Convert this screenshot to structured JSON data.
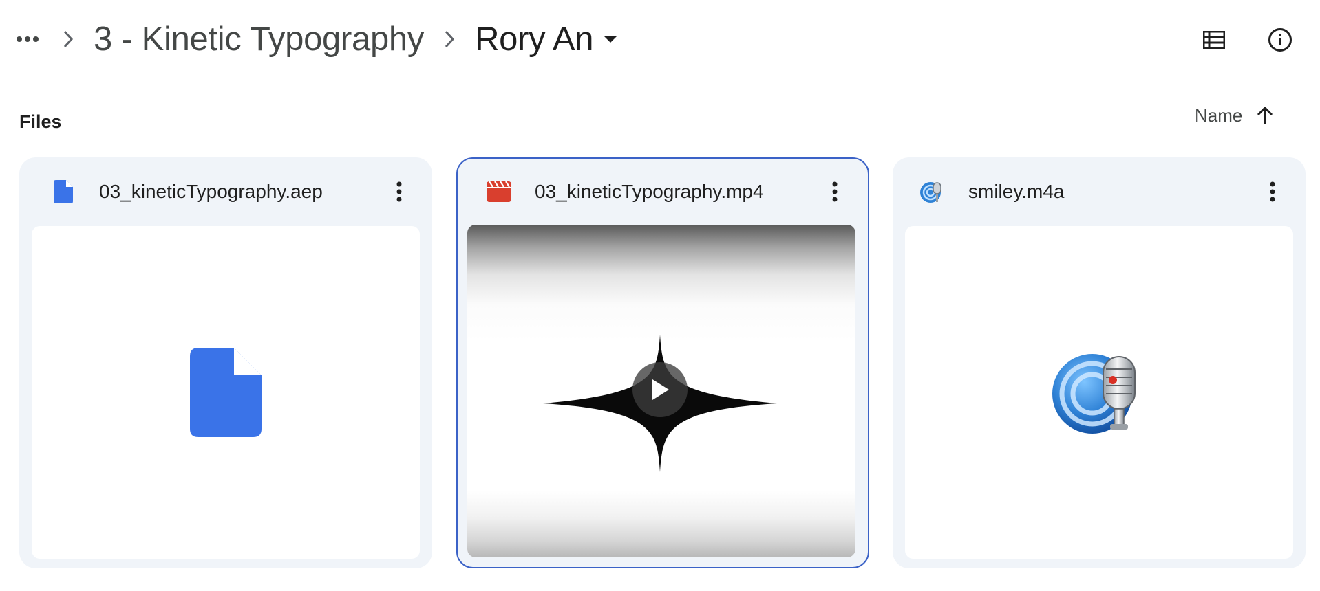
{
  "breadcrumb": {
    "more_label": "More",
    "parent": "3 - Kinetic Typography",
    "current": "Rory An"
  },
  "toolbar": {
    "list_view_icon": "list-view-icon",
    "info_icon": "info-icon"
  },
  "section": {
    "title": "Files"
  },
  "sort": {
    "label": "Name",
    "direction": "ascending"
  },
  "files": [
    {
      "name": "03_kineticTypography.aep",
      "type_icon": "file-icon",
      "accent": "#3a73e8"
    },
    {
      "name": "03_kineticTypography.mp4",
      "type_icon": "video-icon",
      "accent": "#d93f2e"
    },
    {
      "name": "smiley.m4a",
      "type_icon": "audio-icon",
      "accent": "#2f82d6"
    }
  ],
  "colors": {
    "selected_border": "#3b62c7",
    "card_bg": "#f0f4f9"
  }
}
